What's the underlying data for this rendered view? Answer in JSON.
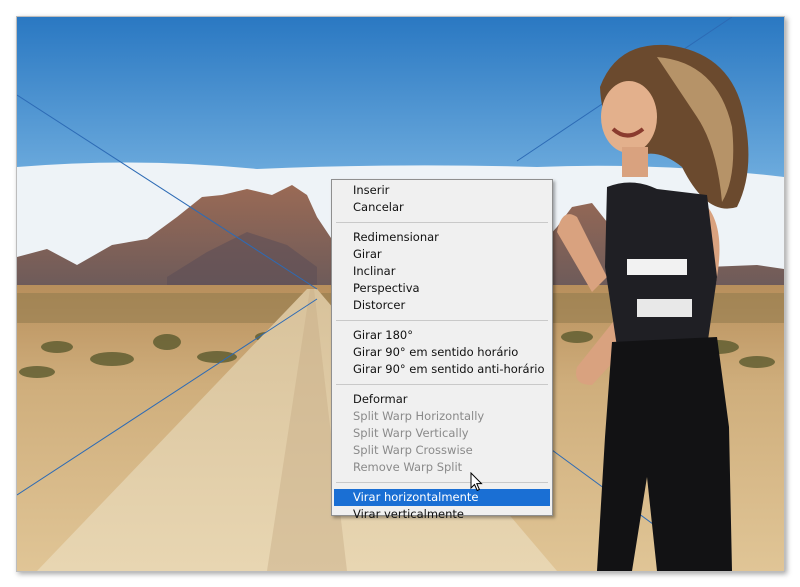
{
  "canvas": {
    "description_icon": "photo-composite",
    "colors": {
      "sky_top": "#2f7cc4",
      "sky_bottom": "#bcd9ee",
      "ground": "#d9b98a",
      "guide_line": "#2d6bb5"
    }
  },
  "context_menu": {
    "groups": [
      [
        {
          "label": "Inserir",
          "enabled": true
        },
        {
          "label": "Cancelar",
          "enabled": true
        }
      ],
      [
        {
          "label": "Redimensionar",
          "enabled": true
        },
        {
          "label": "Girar",
          "enabled": true
        },
        {
          "label": "Inclinar",
          "enabled": true
        },
        {
          "label": "Perspectiva",
          "enabled": true
        },
        {
          "label": "Distorcer",
          "enabled": true
        }
      ],
      [
        {
          "label": "Girar 180°",
          "enabled": true
        },
        {
          "label": "Girar 90° em sentido horário",
          "enabled": true
        },
        {
          "label": "Girar 90° em sentido anti-horário",
          "enabled": true
        }
      ],
      [
        {
          "label": "Deformar",
          "enabled": true
        },
        {
          "label": "Split Warp Horizontally",
          "enabled": false
        },
        {
          "label": "Split Warp Vertically",
          "enabled": false
        },
        {
          "label": "Split Warp Crosswise",
          "enabled": false
        },
        {
          "label": "Remove Warp Split",
          "enabled": false
        }
      ],
      [
        {
          "label": "Virar horizontalmente",
          "enabled": true,
          "highlighted": true
        },
        {
          "label": "Virar verticalmente",
          "enabled": true
        }
      ]
    ],
    "highlight_color": "#1a6fd4"
  },
  "cursor": {
    "icon": "arrow-cursor-icon"
  }
}
